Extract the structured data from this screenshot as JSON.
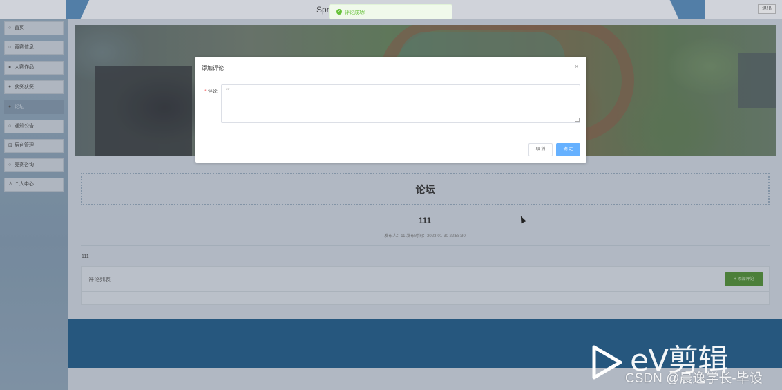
{
  "header": {
    "site_title": "Spri                                                          的设计与实现",
    "logout_label": "退出"
  },
  "sidebar": {
    "items": [
      {
        "icon": "○",
        "label": "首页"
      },
      {
        "icon": "○",
        "label": "竞赛信息"
      },
      {
        "icon": "●",
        "label": "大赛作品"
      },
      {
        "icon": "●",
        "label": "获奖获奖"
      },
      {
        "icon": "●",
        "label": "论坛"
      },
      {
        "icon": "○",
        "label": "通知公告"
      },
      {
        "icon": "⊞",
        "label": "后台管理"
      },
      {
        "icon": "○",
        "label": "竞赛咨询"
      },
      {
        "icon": "♙",
        "label": "个人中心"
      }
    ]
  },
  "forum": {
    "heading": "论坛",
    "post_title": "111",
    "post_meta": "发布人：11  发布时间：2023-01-30 22:58:30",
    "post_body": "111",
    "comments_title": "评论列表",
    "add_comment_label": "+ 添加评论"
  },
  "toast": {
    "message": "评论成功!",
    "icon": "check-circle-icon"
  },
  "dialog": {
    "title": "添加评论",
    "close_glyph": "×",
    "field_label": "评论",
    "required_mark": "*",
    "field_value": "**",
    "cancel_label": "取 消",
    "ok_label": "确 定"
  },
  "watermark": {
    "brand": "eV剪辑",
    "csdn": "CSDN @晨逸学长-毕设"
  },
  "colors": {
    "primary": "#66b1ff",
    "success": "#67c23a",
    "add_button": "#4d8a32",
    "footer": "#1f5a85"
  }
}
